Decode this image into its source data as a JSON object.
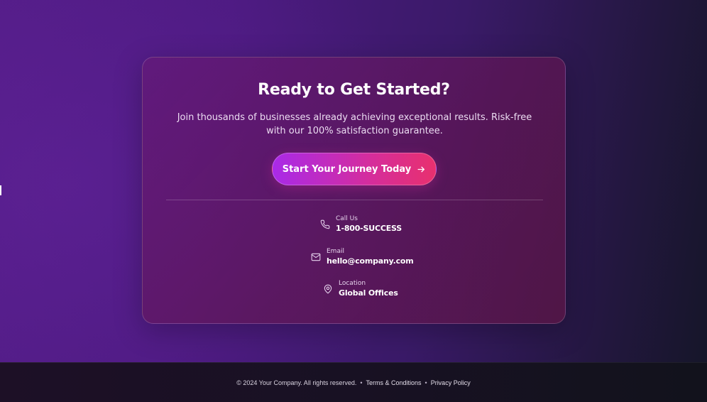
{
  "page": {
    "colors": {
      "accent_gradient_start": "#a92ae8",
      "accent_gradient_end": "#e8306e",
      "background_left": "#521c86",
      "background_right": "#151628"
    }
  },
  "cta_section": {
    "headline": "Ready to Get Started?",
    "subtext": "Join thousands of businesses already achieving exceptional results. Risk-free with our 100% satisfaction guarantee.",
    "button_label": "Start Your Journey Today",
    "button_icon": "arrow-right-icon"
  },
  "contacts": [
    {
      "icon": "phone-icon",
      "label": "Call Us",
      "value": "1-800-SUCCESS"
    },
    {
      "icon": "mail-icon",
      "label": "Email",
      "value": "hello@company.com"
    },
    {
      "icon": "map-pin-icon",
      "label": "Location",
      "value": "Global Offices"
    }
  ],
  "footer": {
    "copyright": "© 2024 Your Company. All rights reserved.",
    "separator": "•",
    "links": [
      "Terms & Conditions",
      "Privacy Policy"
    ]
  }
}
